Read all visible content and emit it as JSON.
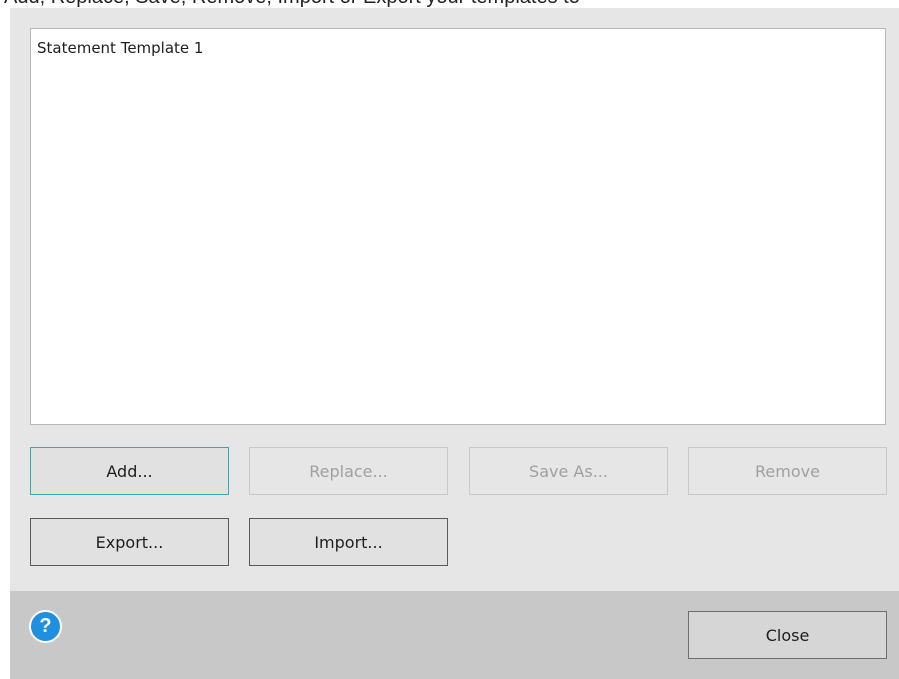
{
  "caption": "Add, Replace, Save, Remove, Import or Export your templates to",
  "templates": [
    "Statement Template 1"
  ],
  "buttons": {
    "add": "Add...",
    "replace": "Replace...",
    "save_as": "Save As...",
    "remove": "Remove",
    "export": "Export...",
    "import": "Import..."
  },
  "footer": {
    "help_glyph": "?",
    "close": "Close"
  },
  "colors": {
    "dialog_bg": "#e6e6e6",
    "footer_bg": "#c8c8c8",
    "focus_border": "#3aa7b5",
    "help_icon": "#1f8fe0"
  },
  "icons": {
    "help": "help-icon"
  }
}
